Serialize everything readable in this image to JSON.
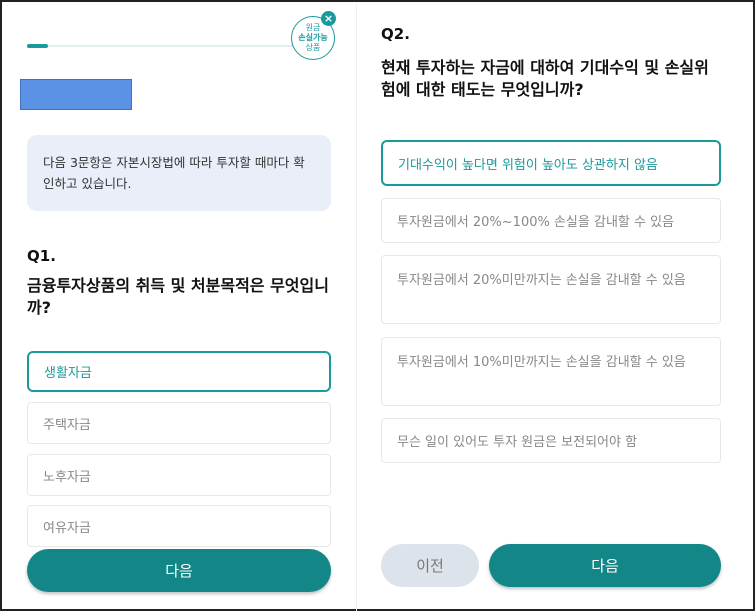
{
  "left": {
    "progress": {
      "fraction": 0.08
    },
    "badge": {
      "line1": "원금",
      "line2": "손실가능",
      "line3": "상품",
      "close": "×"
    },
    "notice": {
      "text": "다음 3문항은 자본시장법에 따라 투자할 때마다 확인하고 있습니다."
    },
    "q1": {
      "number": "Q1.",
      "text": "금융투자상품의 취득 및 처분목적은 무엇입니까?",
      "options": [
        "생활자금",
        "주택자금",
        "노후자금",
        "여유자금"
      ],
      "selected_index": 0
    },
    "next_label": "다음"
  },
  "right": {
    "q2": {
      "number": "Q2.",
      "text": "현재 투자하는 자금에 대하여 기대수익 및 손실위험에 대한 태도는 무엇입니까?",
      "options": [
        "기대수익이 높다면 위험이 높아도 상관하지 않음",
        "투자원금에서 20%~100% 손실을 감내할 수 있음",
        "투자원금에서 20%미만까지는 손실을 감내할 수 있음",
        "투자원금에서 10%미만까지는 손실을 감내할 수 있음",
        "무슨 일이 있어도 투자 원금은 보전되어야 함"
      ],
      "selected_index": 0
    },
    "prev_label": "이전",
    "next_label": "다음"
  },
  "colors": {
    "accent": "#1a9a9c",
    "button": "#138787",
    "notice_bg": "#e9eef9",
    "redaction": "#5b92e5"
  }
}
